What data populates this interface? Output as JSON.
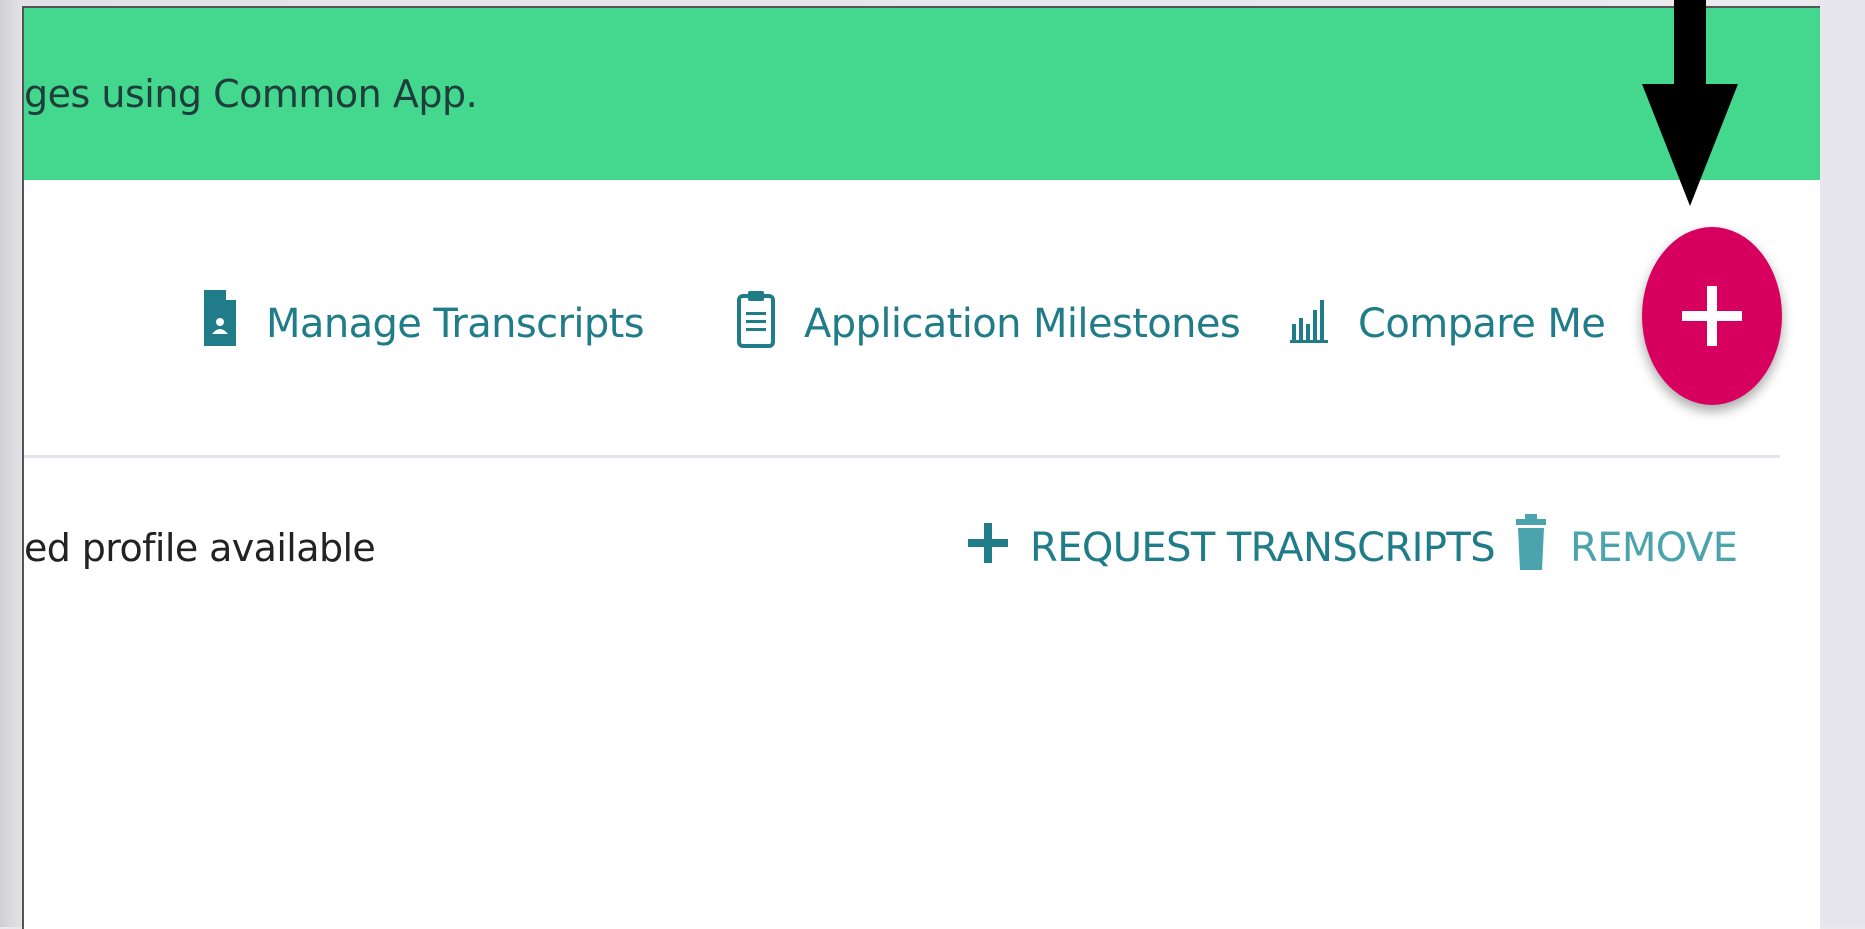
{
  "banner": {
    "text": "ges using Common App.",
    "color": "#44d78e"
  },
  "nav": {
    "items": [
      {
        "label": "Manage Transcripts",
        "icon": "transcript-file-icon"
      },
      {
        "label": "Application Milestones",
        "icon": "clipboard-icon"
      },
      {
        "label": "Compare Me",
        "icon": "bar-chart-icon"
      }
    ],
    "color": "#1f7c88"
  },
  "fab": {
    "label": "+",
    "color": "#d8005f",
    "icon": "plus-icon"
  },
  "annotation": {
    "icon": "arrow-down-icon"
  },
  "row": {
    "text": "ed profile available",
    "actions": {
      "request_label": "REQUEST TRANSCRIPTS",
      "request_icon": "plus-icon",
      "remove_label": "REMOVE",
      "remove_icon": "trash-icon"
    }
  }
}
